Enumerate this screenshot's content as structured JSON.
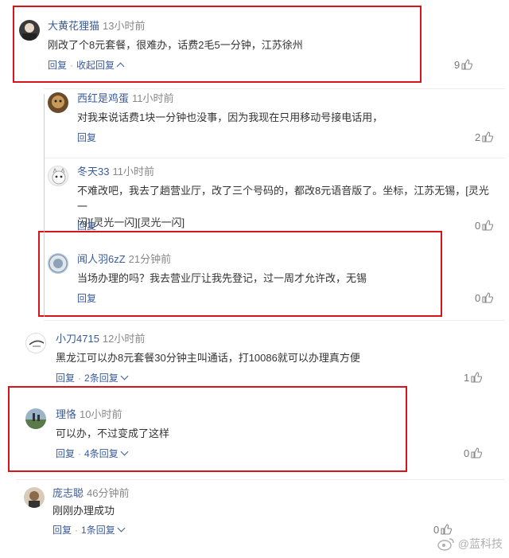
{
  "comments": [
    {
      "user": "大黄花狸猫",
      "time": "13小时前",
      "text": "刚改了个8元套餐，很难办，话费2毛5一分钟，江苏徐州",
      "reply": "回复",
      "more": "收起回复",
      "likes": "9"
    },
    {
      "user": "西红是鸡蛋",
      "time": "11小时前",
      "text": "对我来说话费1块一分钟也没事，因为我现在只用移动号接电话用，",
      "reply": "回复",
      "likes": "2"
    },
    {
      "user": "冬天33",
      "time": "11小时前",
      "text_line1": "不难改吧，我去了趟营业厅，改了三个号码的，都改8元语音版了。坐标，江苏无锡，[灵光一",
      "text_line2": "闪][灵光一闪][灵光一闪]",
      "reply": "回复",
      "likes": "0"
    },
    {
      "user": "闻人羽6zZ",
      "time": "21分钟前",
      "text": "当场办理的吗？我去营业厅让我先登记，过一周才允许改，无锡",
      "reply": "回复",
      "likes": "0"
    },
    {
      "user": "小刀4715",
      "time": "12小时前",
      "text": "黑龙江可以办8元套餐30分钟主叫通话，打10086就可以办理真方便",
      "reply": "回复",
      "more": "2条回复",
      "likes": "1"
    },
    {
      "user": "理恪",
      "time": "10小时前",
      "text": "可以办，不过变成了这样",
      "reply": "回复",
      "more": "4条回复",
      "likes": "0"
    },
    {
      "user": "庞志聪",
      "time": "46分钟前",
      "text": "刚刚办理成功",
      "reply": "回复",
      "more": "1条回复",
      "likes": "0"
    }
  ],
  "watermark": "@蓝科技",
  "colors": {
    "username": "#3a5b9a",
    "highlight_box": "#d7141c",
    "meta": "#888888"
  },
  "icons": [
    "thumbs-up-icon",
    "chevron-down-icon",
    "chevron-up-icon",
    "weibo-logo-icon"
  ]
}
